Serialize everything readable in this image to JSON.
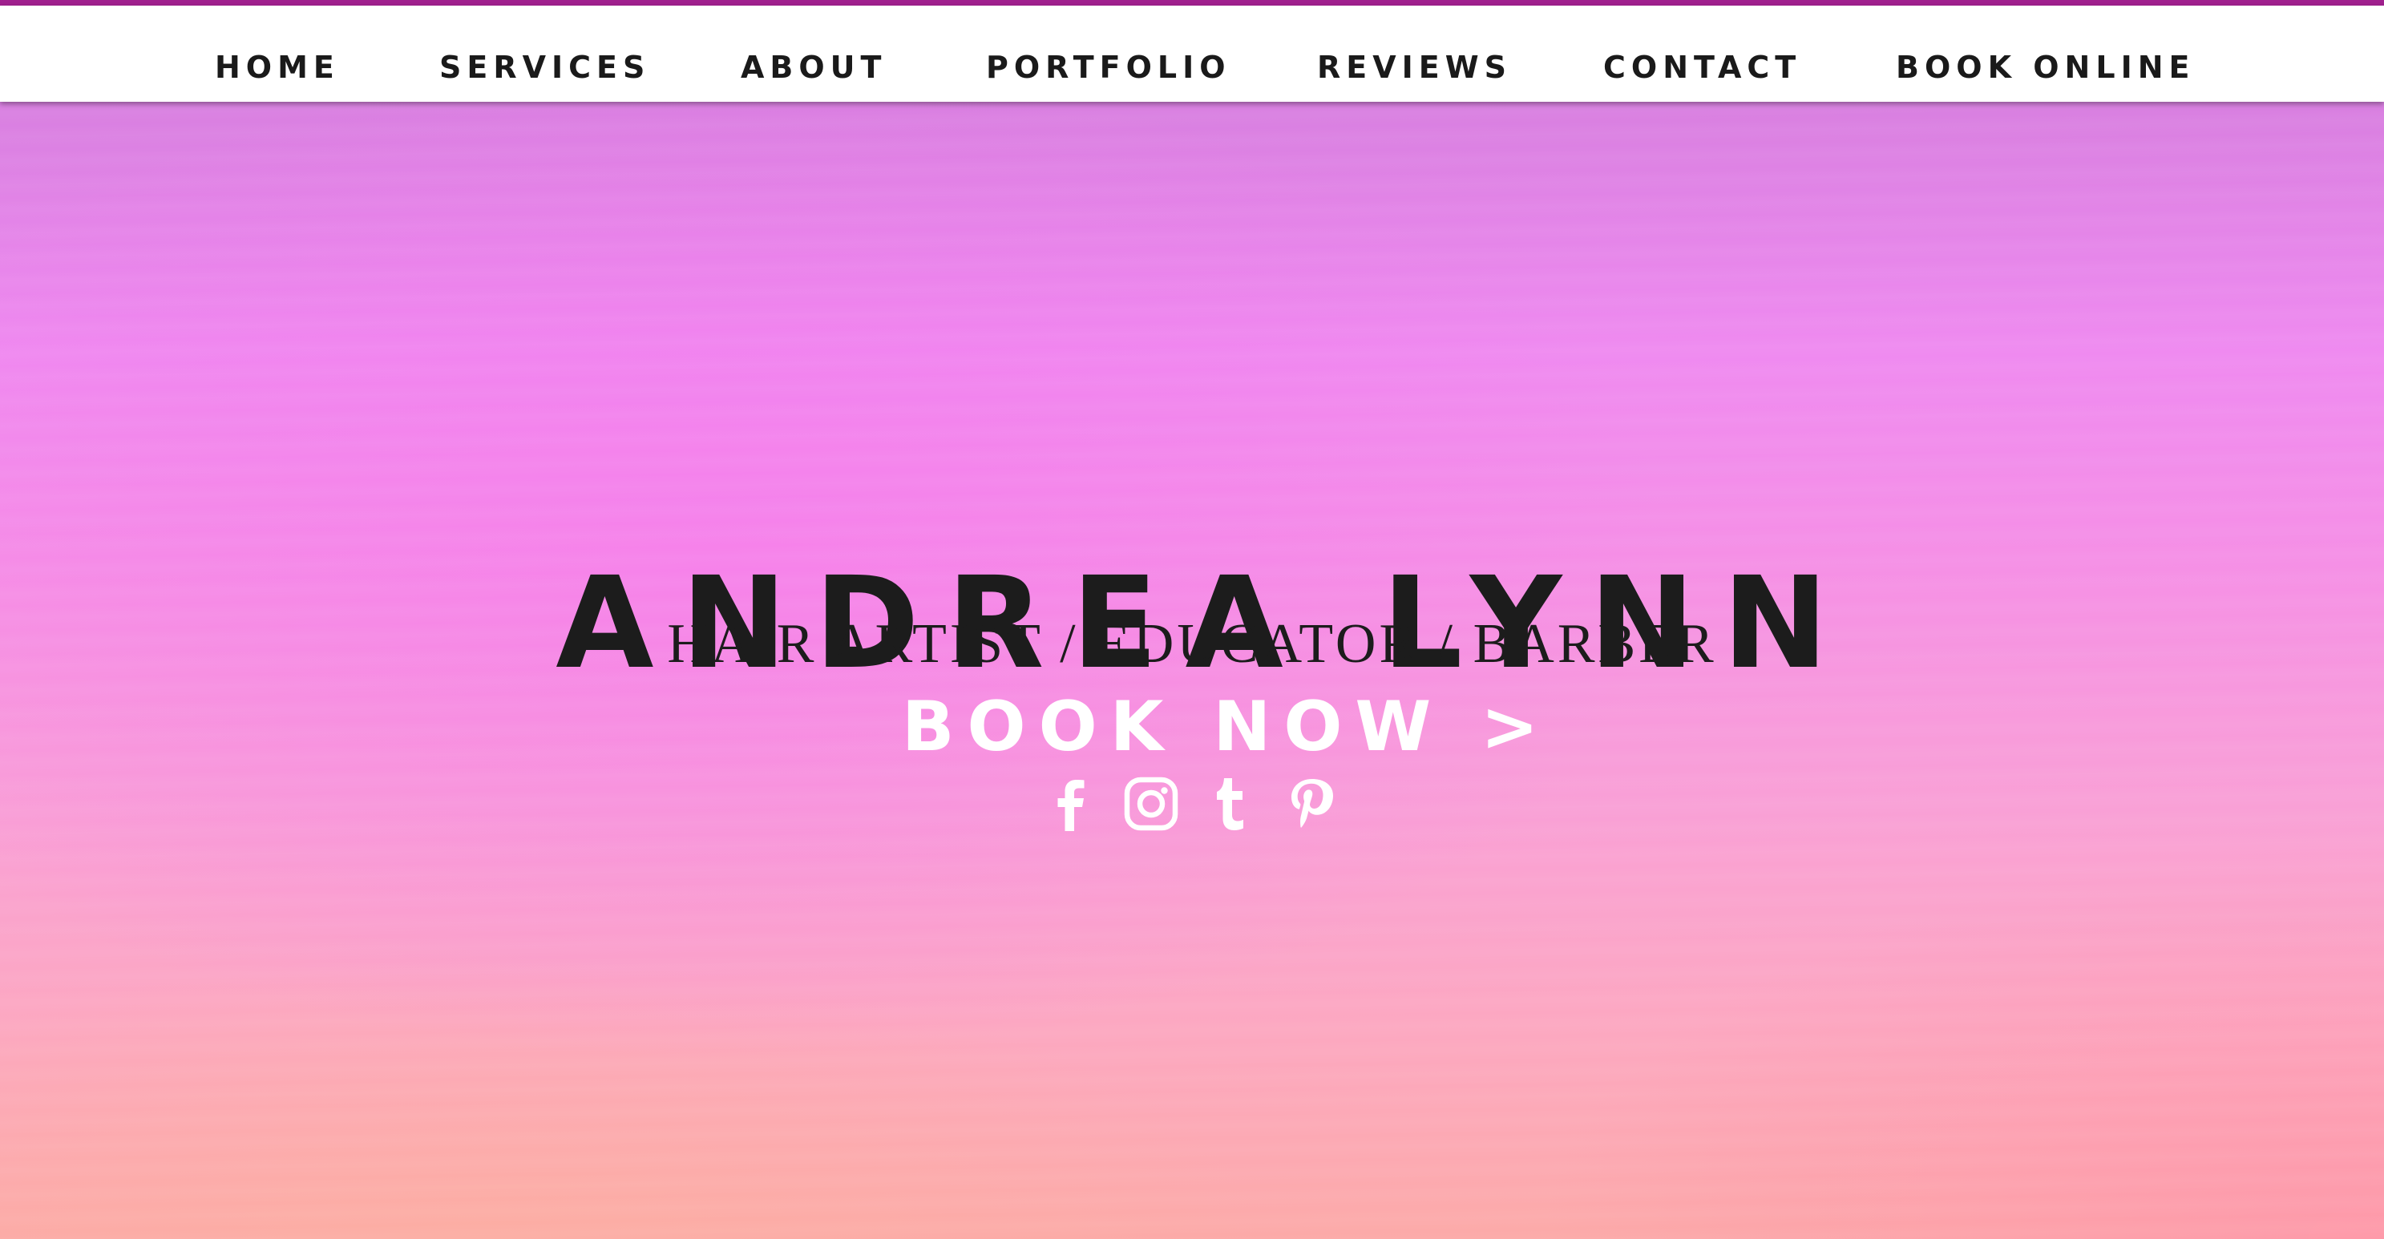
{
  "nav": {
    "items": [
      {
        "label": "HOME"
      },
      {
        "label": "SERVICES"
      },
      {
        "label": "ABOUT"
      },
      {
        "label": "PORTFOLIO"
      },
      {
        "label": "REVIEWS"
      },
      {
        "label": "CONTACT"
      },
      {
        "label": "BOOK ONLINE"
      }
    ]
  },
  "hero": {
    "name": "ANDREA LYNN",
    "tagline": "HAIR ARTIST / EDUCATOR / BARBER",
    "cta_label": "BOOK NOW >"
  },
  "social": {
    "icons": [
      "facebook-icon",
      "instagram-icon",
      "tumblr-icon",
      "pinterest-icon"
    ]
  },
  "colors": {
    "accent": "#a0208e",
    "text_dark": "#1c1c1c",
    "text_light": "#ffffff",
    "hero_top": "#d87fe0",
    "hero_mid": "#f58fe6",
    "hero_bottom": "#fcaaa8"
  }
}
